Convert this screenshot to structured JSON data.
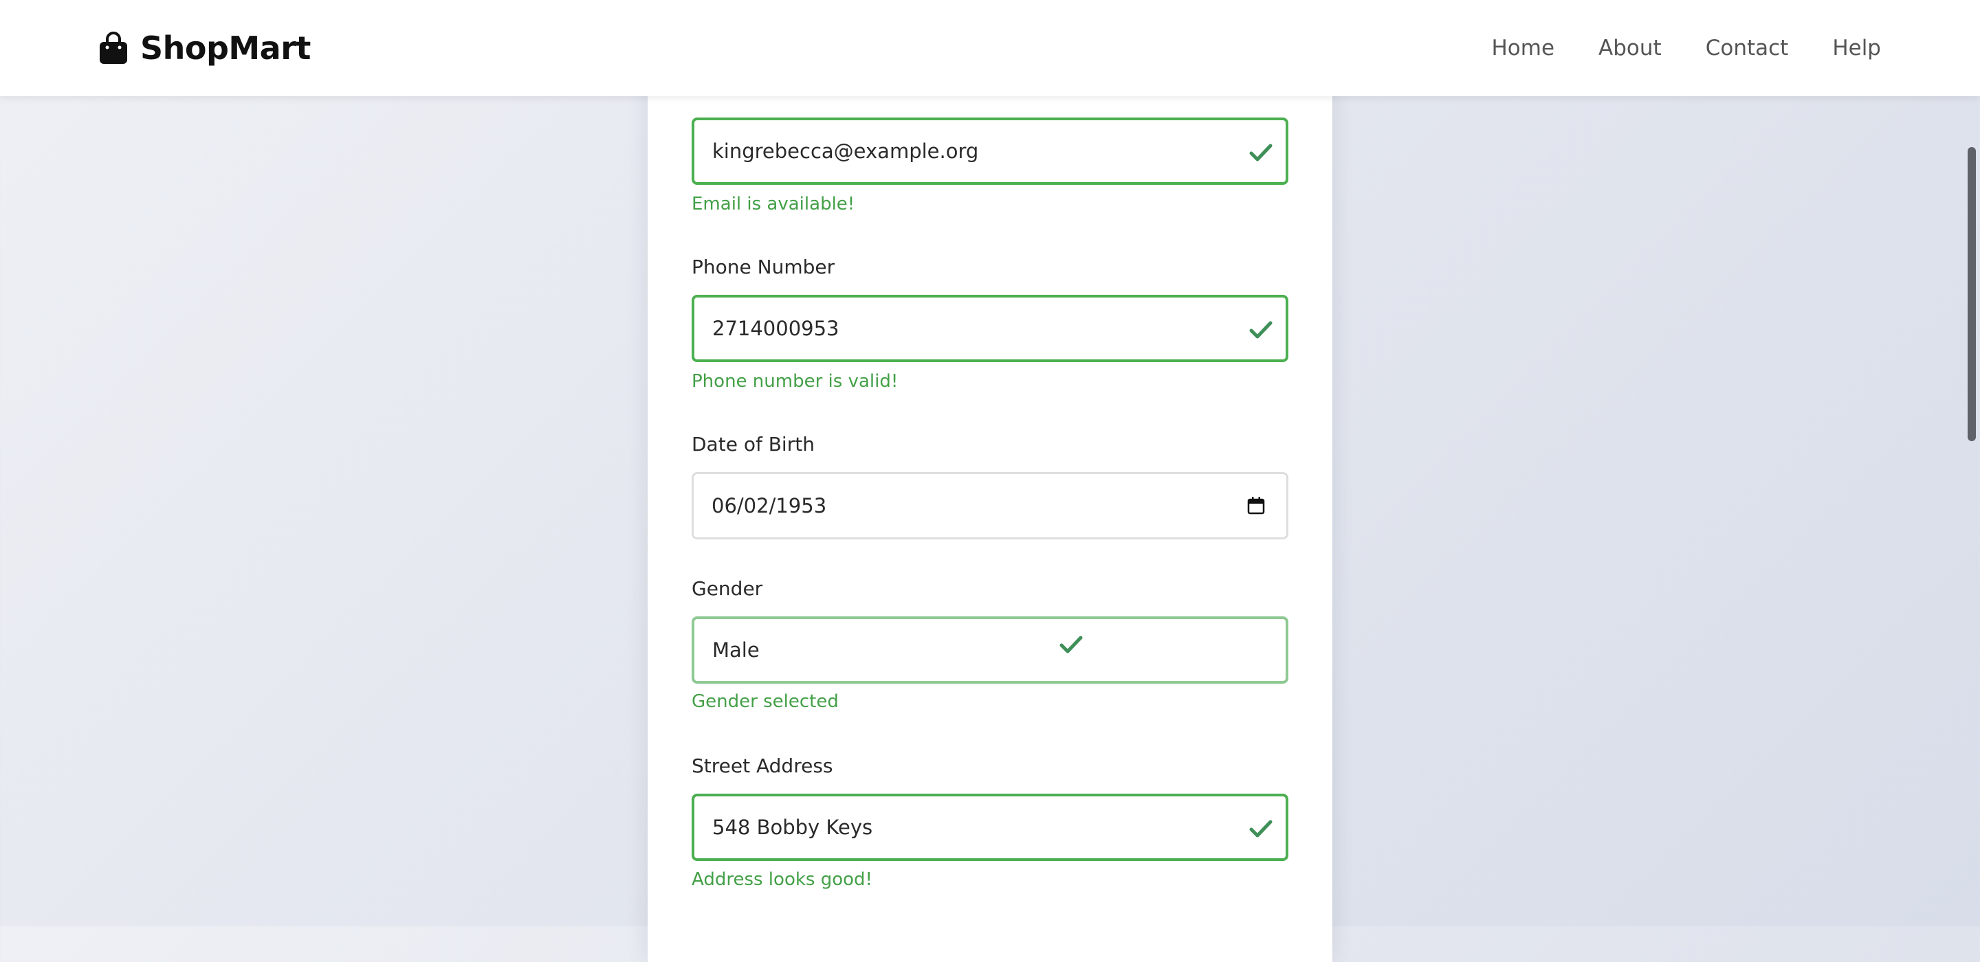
{
  "header": {
    "brand_name": "ShopMart",
    "brand_icon": "shopping-bag-icon",
    "nav": [
      "Home",
      "About",
      "Contact",
      "Help"
    ]
  },
  "form": {
    "email": {
      "value": "kingrebecca@example.org",
      "help": "Email is available!"
    },
    "phone": {
      "label": "Phone Number",
      "value": "2714000953",
      "help": "Phone number is valid!"
    },
    "dob": {
      "label": "Date of Birth",
      "value": "06/02/1953",
      "icon": "calendar-icon"
    },
    "gender": {
      "label": "Gender",
      "value": "Male",
      "help": "Gender selected"
    },
    "address": {
      "label": "Street Address",
      "value": "548 Bobby Keys",
      "help": "Address looks good!"
    }
  },
  "colors": {
    "valid_border": "#4caf50",
    "valid_text": "#43a047",
    "check_icon": "#3f8f58",
    "neutral_border": "#dedede"
  }
}
